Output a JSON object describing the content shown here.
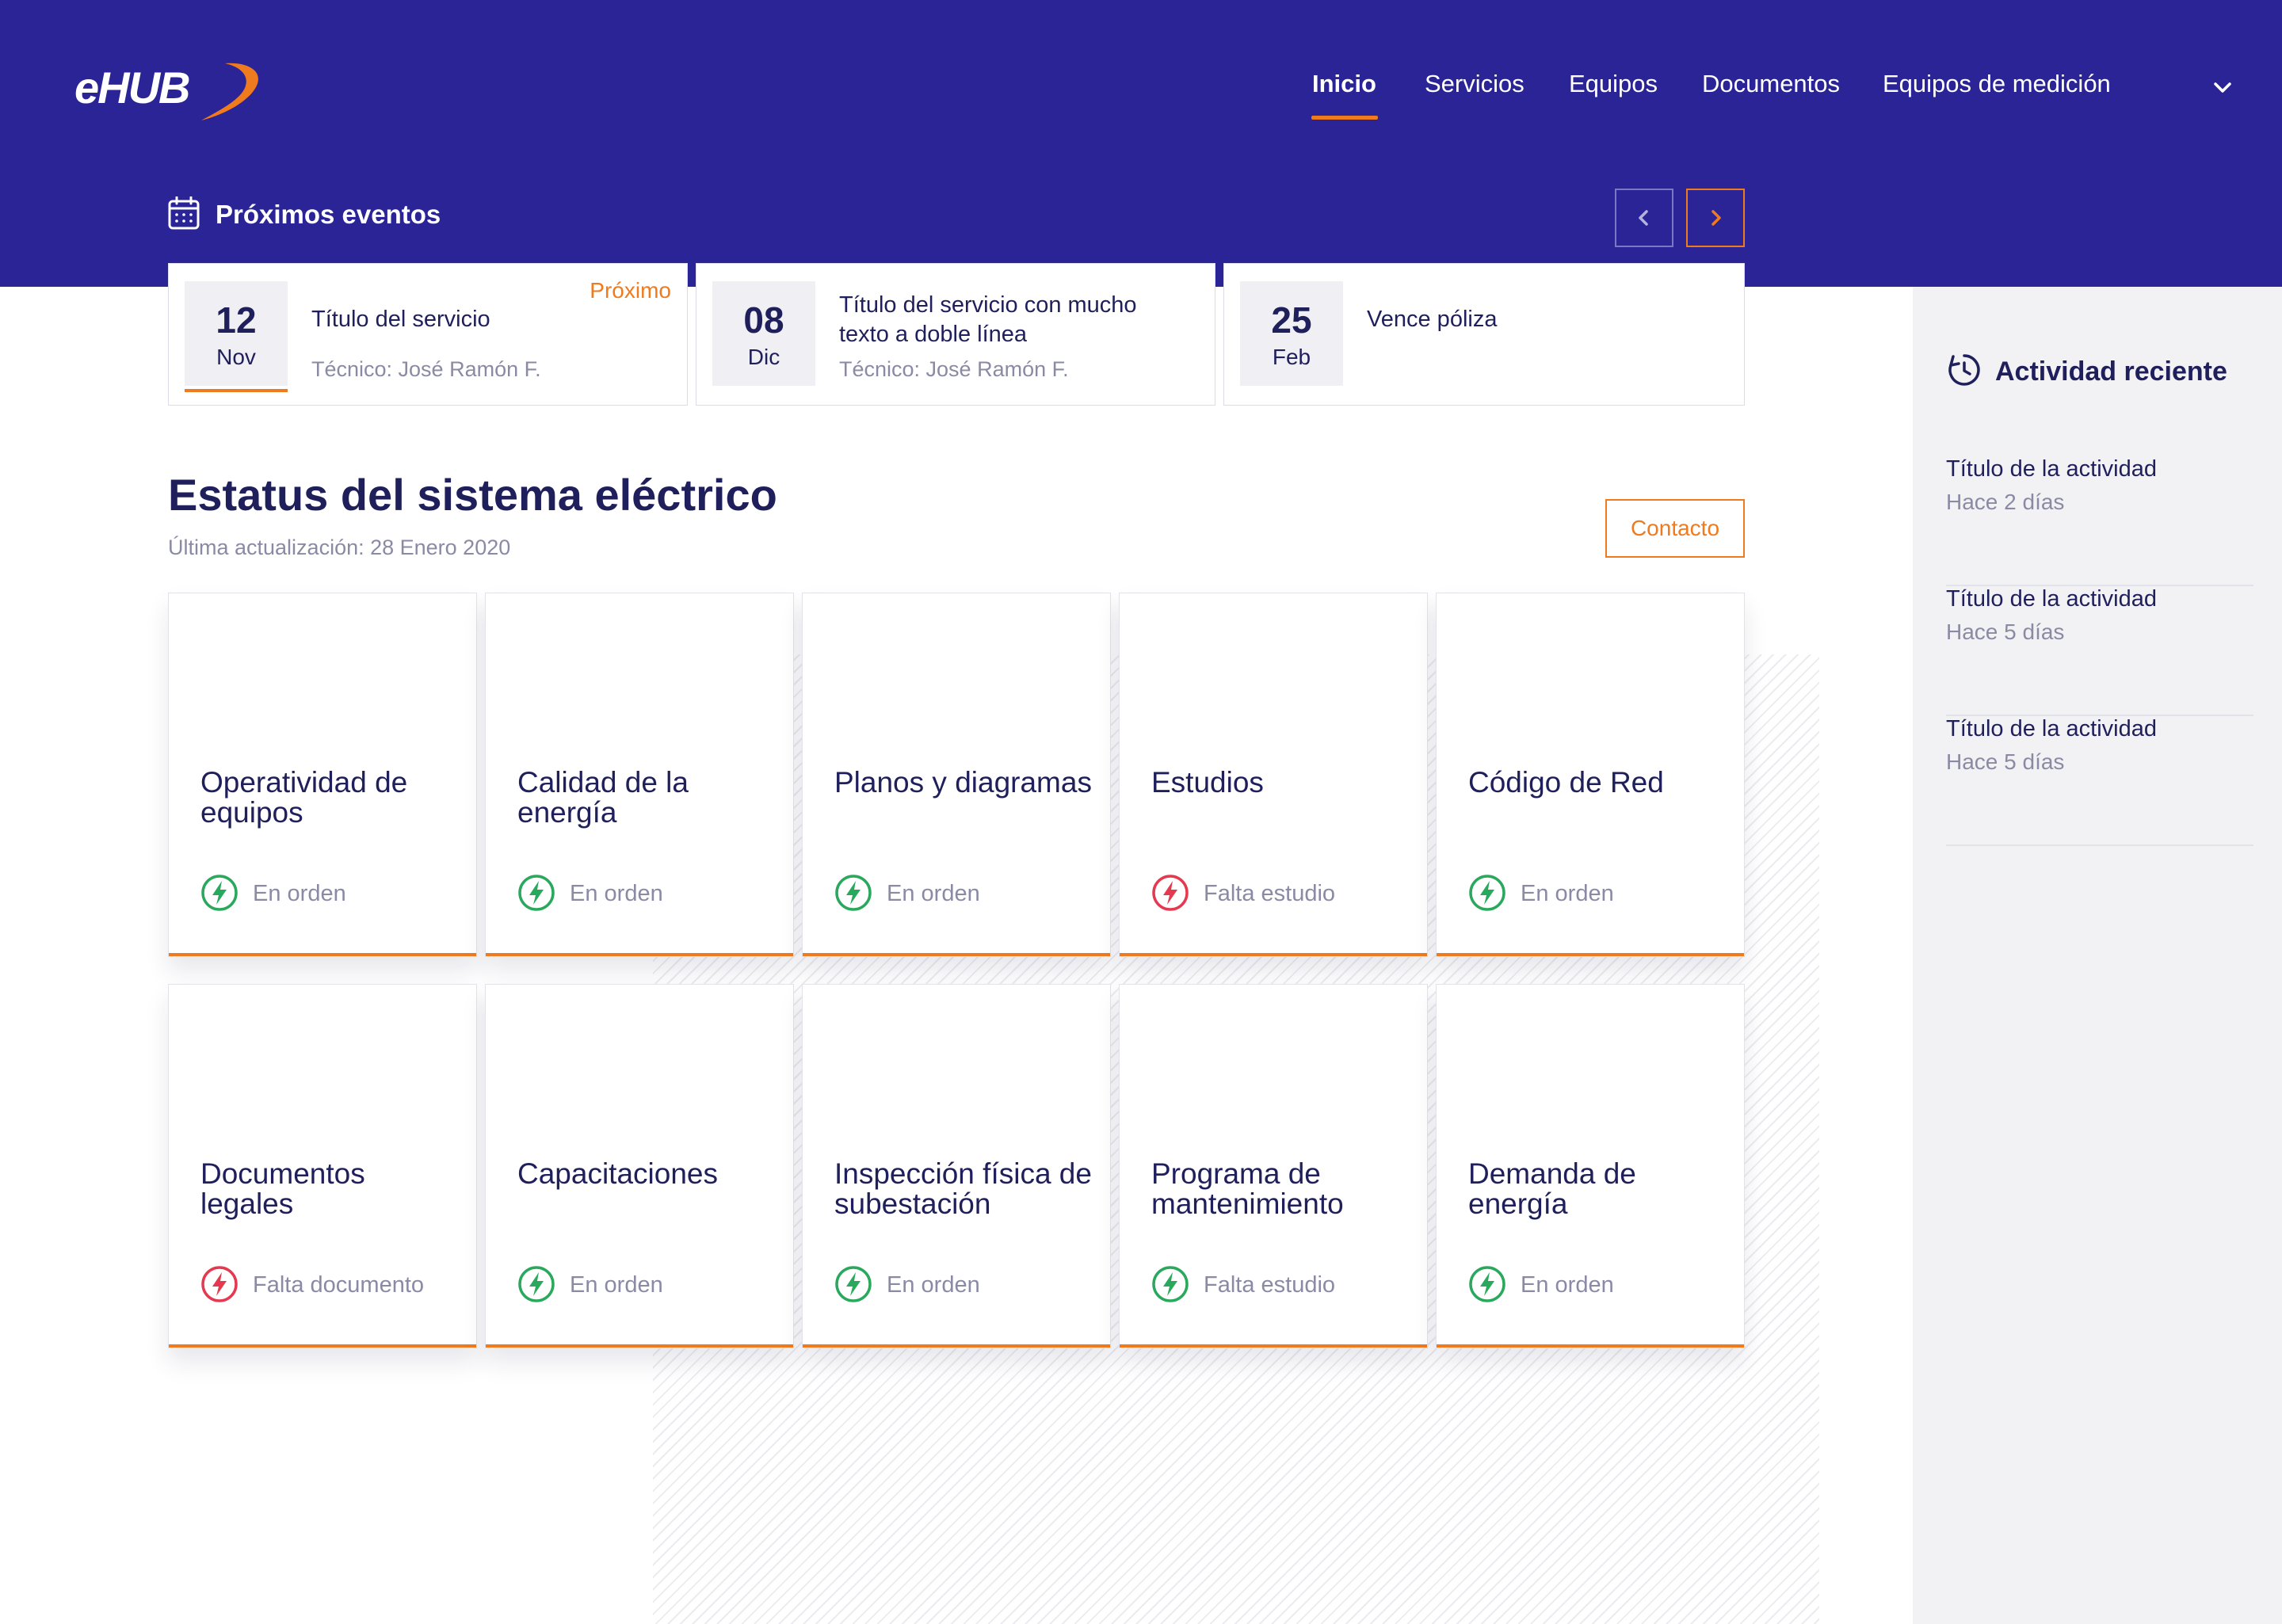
{
  "brand": {
    "name": "eHUB",
    "accent": "#f07a1e",
    "primary": "#2a2496"
  },
  "nav": {
    "items": [
      {
        "label": "Inicio",
        "active": true
      },
      {
        "label": "Servicios"
      },
      {
        "label": "Equipos"
      },
      {
        "label": "Documentos"
      },
      {
        "label": "Equipos de medición"
      }
    ],
    "more_icon": "chevron-down-icon"
  },
  "events": {
    "heading": "Próximos eventos",
    "icon": "calendar-icon",
    "prev_icon": "chevron-left-icon",
    "next_icon": "chevron-right-icon",
    "items": [
      {
        "day": "12",
        "month": "Nov",
        "title": "Título del servicio",
        "subtitle": "Técnico: José Ramón F.",
        "badge": "Próximo"
      },
      {
        "day": "08",
        "month": "Dic",
        "title": "Título del servicio con mucho texto a doble línea",
        "subtitle": "Técnico: José Ramón F."
      },
      {
        "day": "25",
        "month": "Feb",
        "title": "Vence póliza"
      }
    ]
  },
  "status": {
    "title": "Estatus del sistema eléctrico",
    "updated": "Última actualización: 28 Enero 2020",
    "contact_label": "Contacto",
    "ok_color": "#2aa85c",
    "alert_color": "#e53950",
    "tiles": [
      {
        "name": "Operatividad de equipos",
        "status": "En orden",
        "state": "ok"
      },
      {
        "name": "Calidad de la energía",
        "status": "En orden",
        "state": "ok"
      },
      {
        "name": "Planos y diagramas",
        "status": "En orden",
        "state": "ok"
      },
      {
        "name": "Estudios",
        "status": "Falta estudio",
        "state": "alert"
      },
      {
        "name": "Código de Red",
        "status": "En orden",
        "state": "ok"
      },
      {
        "name": "Documentos legales",
        "status": "Falta documento",
        "state": "alert"
      },
      {
        "name": "Capacitaciones",
        "status": "En orden",
        "state": "ok"
      },
      {
        "name": "Inspección física de subestación",
        "status": "En orden",
        "state": "ok"
      },
      {
        "name": "Programa de mantenimiento",
        "status": "Falta estudio",
        "state": "ok"
      },
      {
        "name": "Demanda de energía",
        "status": "En orden",
        "state": "ok"
      }
    ]
  },
  "activity": {
    "heading": "Actividad reciente",
    "icon": "clock-history-icon",
    "items": [
      {
        "title": "Título de la actividad",
        "time": "Hace 2 días"
      },
      {
        "title": "Título de la actividad",
        "time": "Hace 5 días"
      },
      {
        "title": "Título de la actividad",
        "time": "Hace 5 días"
      }
    ]
  }
}
